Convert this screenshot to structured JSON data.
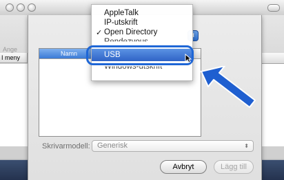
{
  "window": {
    "title_hint": ""
  },
  "background": {
    "partial_label": "Ange",
    "column_label": "I meny"
  },
  "dialog": {
    "list_column": "Namn",
    "model_label": "Skrivarmodell:",
    "model_value": "Generisk",
    "cancel_button": "Avbryt",
    "add_button": "Lägg till"
  },
  "menu": {
    "items": [
      {
        "label": "AppleTalk",
        "checked": false
      },
      {
        "label": "IP-utskrift",
        "checked": false
      },
      {
        "label": "Open Directory",
        "checked": true
      },
      {
        "label": "Rendezvous",
        "checked": false,
        "partial": true
      },
      {
        "label": "USB",
        "checked": false,
        "selected": true
      },
      {
        "label": "Windows-utskrift",
        "checked": false,
        "partial": true
      }
    ],
    "check_glyph": "✓"
  },
  "colors": {
    "selection": "#2f63c6",
    "highlight_ring": "#1e66d6",
    "arrow": "#1f5fd0"
  }
}
